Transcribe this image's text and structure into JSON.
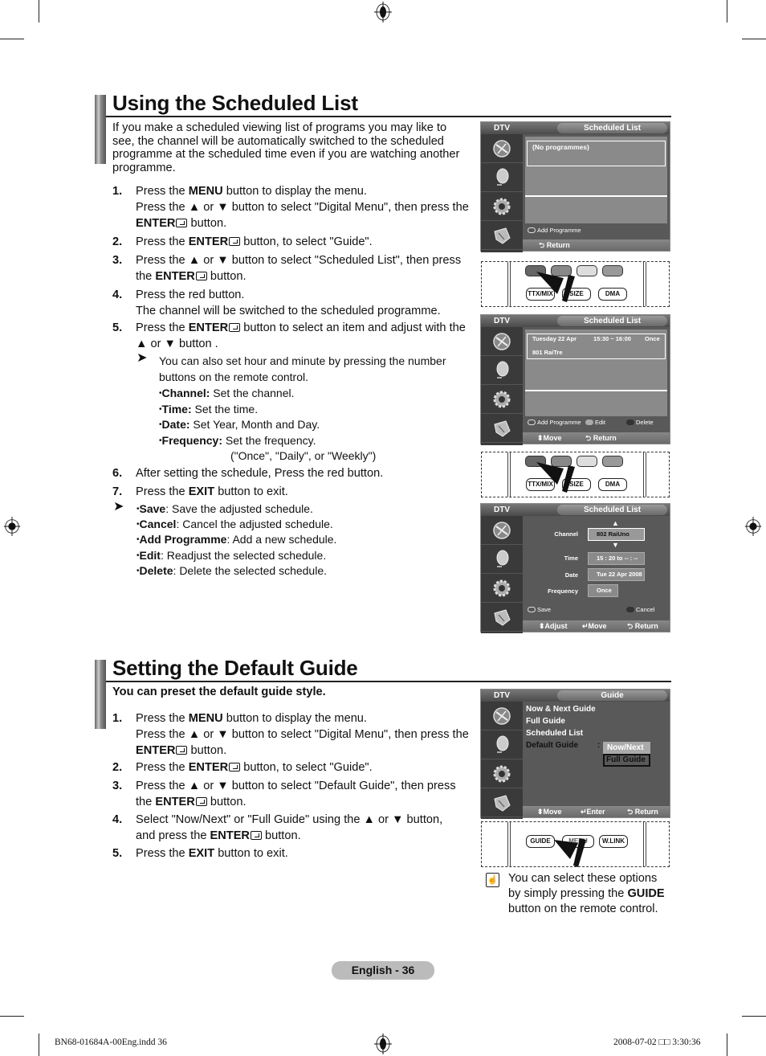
{
  "section1": {
    "title": "Using the Scheduled List",
    "intro": "If you make a scheduled viewing list of programs you may like to see, the channel will be automatically switched to the scheduled programme at the scheduled time even if you are watching another programme.",
    "intro_lines": [
      "If you make a scheduled viewing list of programs you may like to",
      "see, the channel will be automatically switched to the scheduled",
      "programme at the scheduled time even if you are watching another",
      "programme."
    ],
    "steps": [
      {
        "num": "1.",
        "lines": [
          "Press the |MENU| button to display the menu.",
          "Press the ▲ or ▼ button to select \"Digital Menu\", then press the",
          "|ENTER|@ button."
        ]
      },
      {
        "num": "2.",
        "lines": [
          "Press the |ENTER|@ button, to select \"Guide\"."
        ]
      },
      {
        "num": "3.",
        "lines": [
          "Press the ▲ or ▼ button to select \"Scheduled List\", then press",
          "the |ENTER|@ button."
        ]
      },
      {
        "num": "4.",
        "lines": [
          "Press the red button.",
          "The channel will be switched to the scheduled programme."
        ]
      },
      {
        "num": "5.",
        "lines": [
          "Press the |ENTER|@ button to select an item and adjust with the",
          "▲ or ▼ button ."
        ]
      },
      {
        "num": "6.",
        "lines": [
          "After setting the schedule, Press the red button."
        ]
      },
      {
        "num": "7.",
        "lines": [
          "Press the |EXIT| button to exit."
        ]
      }
    ],
    "note1": {
      "text_lines": [
        "You can also set hour and minute by pressing the number",
        "buttons on the remote control."
      ],
      "bullets": [
        {
          "label": "Channel:",
          "text": " Set the channel."
        },
        {
          "label": "Time:",
          "text": " Set the time."
        },
        {
          "label": "Date:",
          "text": " Set Year, Month and Day."
        },
        {
          "label": "Frequency:",
          "text": " Set the frequency."
        }
      ],
      "freq_options": "(\"Once\", \"Daily\", or \"Weekly\")"
    },
    "note2": {
      "bullets": [
        {
          "label": "Save",
          "text": ": Save the adjusted schedule."
        },
        {
          "label": "Cancel",
          "text": ": Cancel the adjusted schedule."
        },
        {
          "label": "Add Programme",
          "text": ": Add a new schedule."
        },
        {
          "label": "Edit",
          "text": ": Readjust the selected schedule."
        },
        {
          "label": "Delete",
          "text": ": Delete the selected schedule."
        }
      ]
    }
  },
  "screen1": {
    "dtv": "DTV",
    "tab": "Scheduled List",
    "empty_text": "(No programmes)",
    "add_programme": "Add Programme",
    "return": "Return"
  },
  "remote1": {
    "buttons": [
      "TTX/MIX",
      "SIZE",
      "DMA"
    ]
  },
  "screen2": {
    "dtv": "DTV",
    "tab": "Scheduled List",
    "entry": {
      "day": "Tuesday  22  Apr",
      "time": "15:30 ~ 16:00",
      "frequency": "Once",
      "channel": "801  RaiTre"
    },
    "add_programme": "Add Programme",
    "edit": "Edit",
    "delete": "Delete",
    "move": "Move",
    "return": "Return"
  },
  "remote2": {
    "buttons": [
      "TTX/MIX",
      "SIZE",
      "DMA"
    ]
  },
  "screen3": {
    "dtv": "DTV",
    "tab": "Scheduled List",
    "fields": [
      {
        "label": "Channel",
        "value": "802 RaiUno"
      },
      {
        "label": "Time",
        "value": "15 : 20 to -- : --"
      },
      {
        "label": "Date",
        "value": "Tue 22 Apr 2008"
      },
      {
        "label": "Frequency",
        "value": "Once"
      }
    ],
    "save": "Save",
    "cancel": "Cancel",
    "adjust": "Adjust",
    "move": "Move",
    "return": "Return"
  },
  "section2": {
    "title": "Setting the Default Guide",
    "intro": "You can preset the default guide style.",
    "steps": [
      {
        "num": "1.",
        "lines": [
          "Press the |MENU| button to display the menu.",
          "Press the ▲ or ▼ button to select \"Digital Menu\", then press the",
          "|ENTER|@ button."
        ]
      },
      {
        "num": "2.",
        "lines": [
          "Press the |ENTER|@ button, to select \"Guide\"."
        ]
      },
      {
        "num": "3.",
        "lines": [
          "Press the ▲ or ▼ button to select \"Default Guide\", then press",
          "the |ENTER|@ button."
        ]
      },
      {
        "num": "4.",
        "lines": [
          "Select \"Now/Next\" or \"Full Guide\" using the ▲ or ▼ button,",
          "and press the |ENTER|@ button."
        ]
      },
      {
        "num": "5.",
        "lines": [
          "Press the |EXIT| button to exit."
        ]
      }
    ]
  },
  "screen4": {
    "dtv": "DTV",
    "tab": "Guide",
    "menu": [
      "Now & Next Guide",
      "Full Guide",
      "Scheduled List",
      "Default Guide"
    ],
    "colon": ":",
    "options": [
      "Now/Next",
      "Full Guide"
    ],
    "move": "Move",
    "enter": "Enter",
    "return": "Return"
  },
  "remote3": {
    "buttons": [
      "GUIDE",
      "MENU",
      "W.LINK"
    ]
  },
  "tip": {
    "lines": [
      "You can select these options",
      "by simply pressing the |GUIDE|",
      "button on the remote control."
    ]
  },
  "footer": {
    "page_label": "English - 36",
    "slug_left": "BN68-01684A-00Eng.indd   36",
    "slug_right": "2008-07-02   □□ 3:30:36"
  }
}
